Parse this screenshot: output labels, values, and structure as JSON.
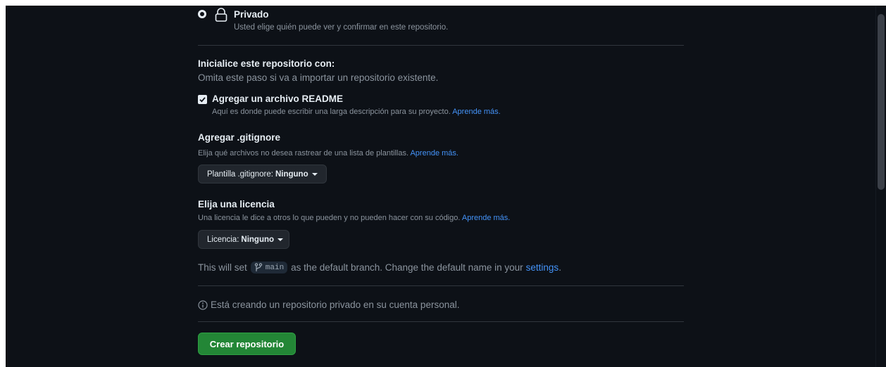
{
  "visibility": {
    "private_label": "Privado",
    "private_desc": "Usted elige quién puede ver y confirmar en este repositorio."
  },
  "initialize": {
    "title": "Inicialice este repositorio con:",
    "subtitle": "Omita este paso si va a importar un repositorio existente.",
    "readme_label": "Agregar un archivo README",
    "readme_checked": true,
    "readme_desc": "Aquí es donde puede escribir una larga descripción para su proyecto.",
    "readme_link": "Aprende más."
  },
  "gitignore": {
    "title": "Agregar .gitignore",
    "desc": "Elija qué archivos no desea rastrear de una lista de plantillas.",
    "link": "Aprende más.",
    "button_prefix": "Plantilla .gitignore:",
    "button_value": "Ninguno"
  },
  "license": {
    "title": "Elija una licencia",
    "desc": "Una licencia le dice a otros lo que pueden y no pueden hacer con su código.",
    "link": "Aprende más.",
    "button_prefix": "Licencia:",
    "button_value": "Ninguno"
  },
  "branch": {
    "before": "This will set",
    "name": "main",
    "after": "as the default branch. Change the default name in your",
    "link": "settings",
    "end": "."
  },
  "notice": {
    "text": "Está creando un repositorio privado en su cuenta personal."
  },
  "submit": {
    "label": "Crear repositorio"
  },
  "colors": {
    "background": "#0d1117",
    "link": "#4493f8",
    "primary_button": "#238636"
  }
}
